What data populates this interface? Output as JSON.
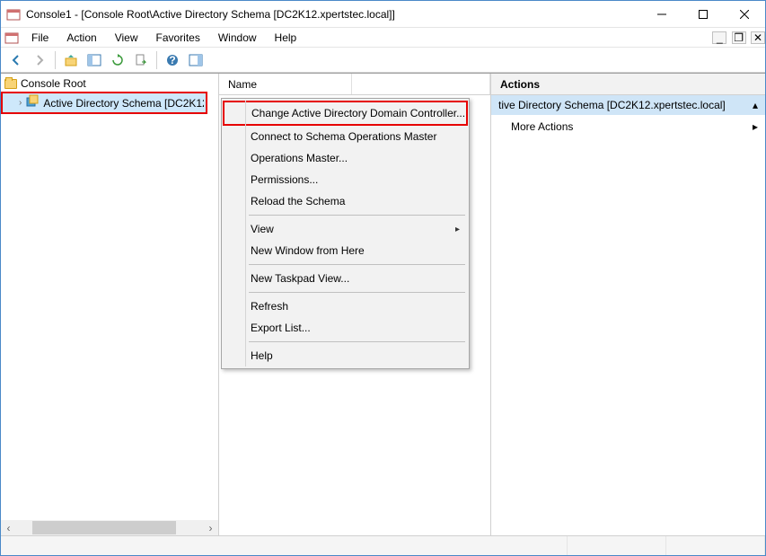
{
  "title": "Console1 - [Console Root\\Active Directory Schema [DC2K12.xpertstec.local]]",
  "menu": {
    "file": "File",
    "action": "Action",
    "view": "View",
    "favorites": "Favorites",
    "window": "Window",
    "help": "Help"
  },
  "tree": {
    "root": "Console Root",
    "child": "Active Directory Schema [DC2K12."
  },
  "list": {
    "col_name": "Name"
  },
  "actions": {
    "header": "Actions",
    "topic": "tive Directory Schema [DC2K12.xpertstec.local]",
    "more": "More Actions"
  },
  "context": {
    "change_dc": "Change Active Directory Domain Controller...",
    "connect_master": "Connect to Schema Operations Master",
    "op_master": "Operations Master...",
    "permissions": "Permissions...",
    "reload": "Reload the Schema",
    "view": "View",
    "new_window": "New Window from Here",
    "new_taskpad": "New Taskpad View...",
    "refresh": "Refresh",
    "export": "Export List...",
    "help": "Help"
  }
}
